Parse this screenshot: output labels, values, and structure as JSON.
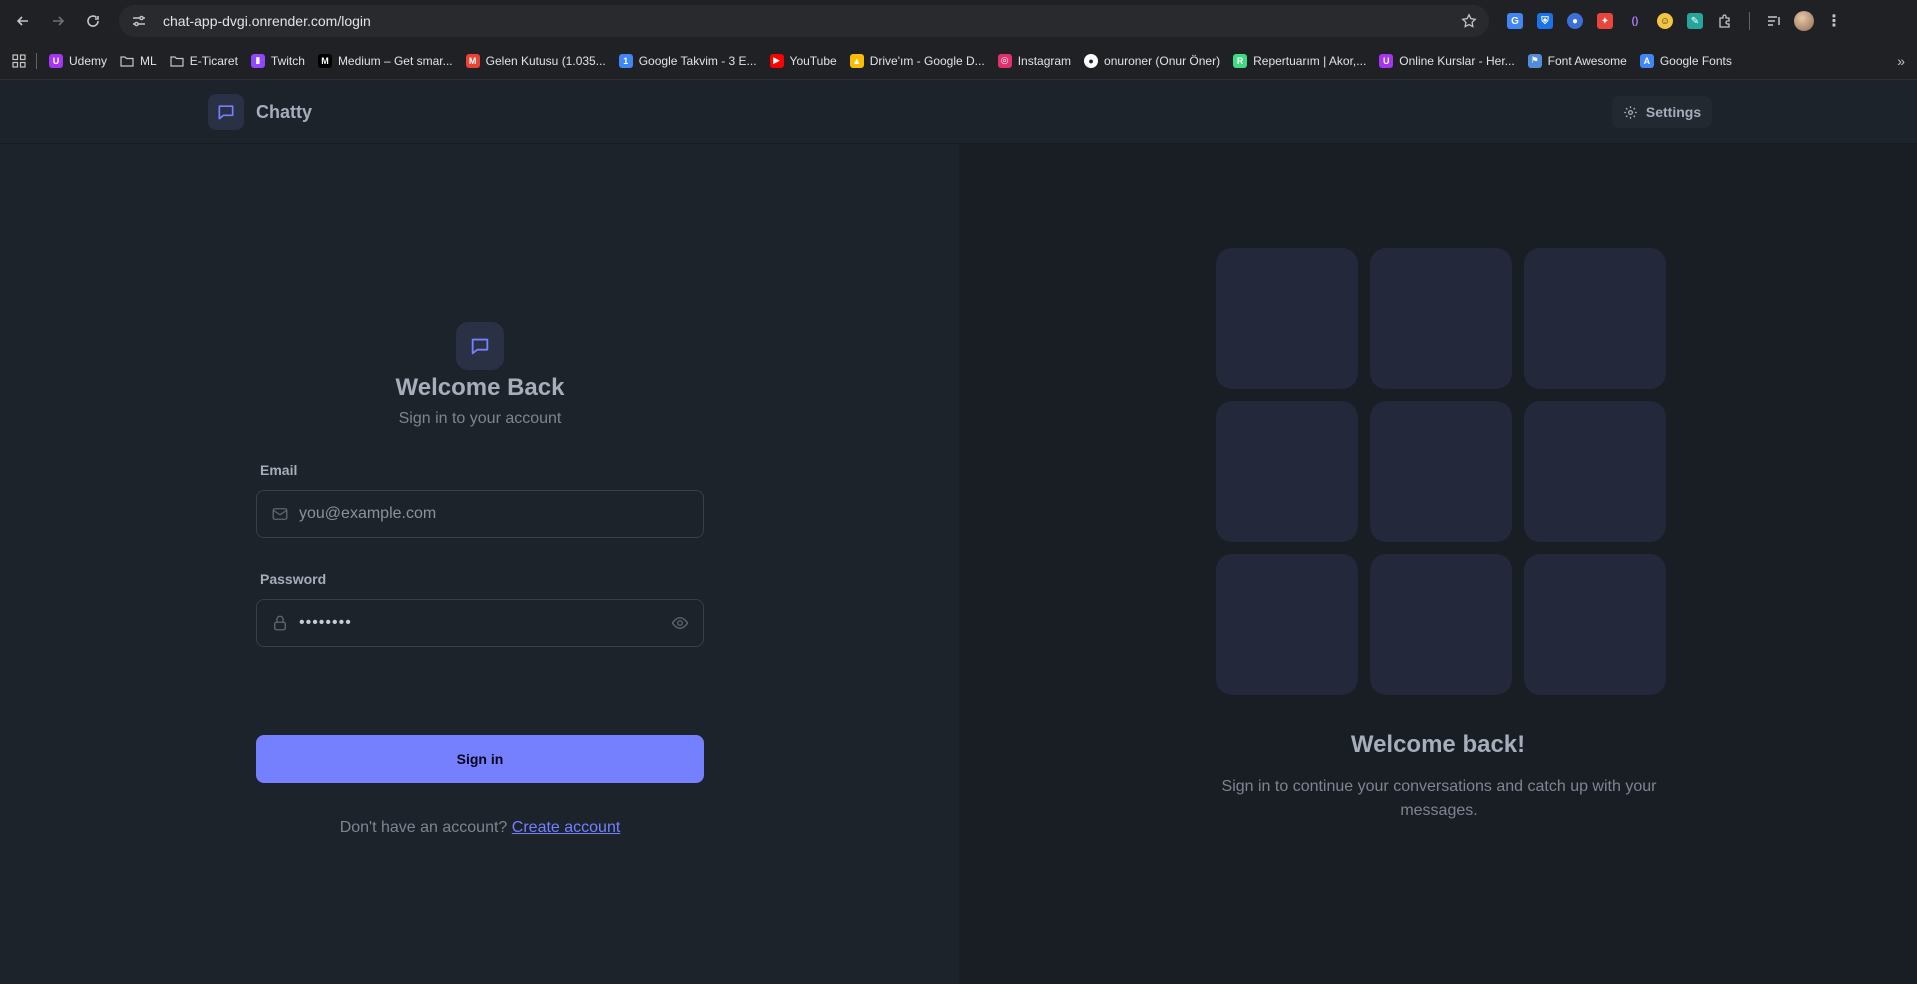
{
  "browser": {
    "url": "chat-app-dvgi.onrender.com/login",
    "bookmarks": [
      {
        "label": "Udemy",
        "icon": "udemy-icon",
        "color": "#a435f0"
      },
      {
        "label": "ML",
        "icon": "folder-icon",
        "color": ""
      },
      {
        "label": "E-Ticaret",
        "icon": "folder-icon",
        "color": ""
      },
      {
        "label": "Twitch",
        "icon": "twitch-icon",
        "color": "#9146ff"
      },
      {
        "label": "Medium – Get smar...",
        "icon": "medium-icon",
        "color": "#000000"
      },
      {
        "label": "Gelen Kutusu (1.035...",
        "icon": "gmail-icon",
        "color": "#ea4335"
      },
      {
        "label": "Google Takvim - 3 E...",
        "icon": "calendar-icon",
        "color": "#4285f4"
      },
      {
        "label": "YouTube",
        "icon": "youtube-icon",
        "color": "#ff0000"
      },
      {
        "label": "Drive'ım - Google D...",
        "icon": "drive-icon",
        "color": "#fbbc04"
      },
      {
        "label": "Instagram",
        "icon": "instagram-icon",
        "color": "#e1306c"
      },
      {
        "label": "onuroner (Onur Öner)",
        "icon": "github-icon",
        "color": "#ffffff"
      },
      {
        "label": "Repertuarım | Akor,...",
        "icon": "repertuar-icon",
        "color": "#3ddc84"
      },
      {
        "label": "Online Kurslar - Her...",
        "icon": "udemy-icon",
        "color": "#a435f0"
      },
      {
        "label": "Font Awesome",
        "icon": "flag-icon",
        "color": "#528dd7"
      },
      {
        "label": "Google Fonts",
        "icon": "google-fonts-icon",
        "color": "#4285f4"
      }
    ]
  },
  "header": {
    "brand": "Chatty",
    "settings_label": "Settings"
  },
  "login": {
    "title": "Welcome Back",
    "subtitle": "Sign in to your account",
    "email_label": "Email",
    "email_placeholder": "you@example.com",
    "password_label": "Password",
    "password_value": "••••••••",
    "submit_label": "Sign in",
    "signup_prompt": "Don't have an account?",
    "signup_link": "Create account"
  },
  "promo": {
    "title": "Welcome back!",
    "text": "Sign in to continue your conversations and catch up with your messages."
  },
  "colors": {
    "primary": "#7480ff",
    "base": "#1d232a",
    "tile": "#23283a"
  }
}
